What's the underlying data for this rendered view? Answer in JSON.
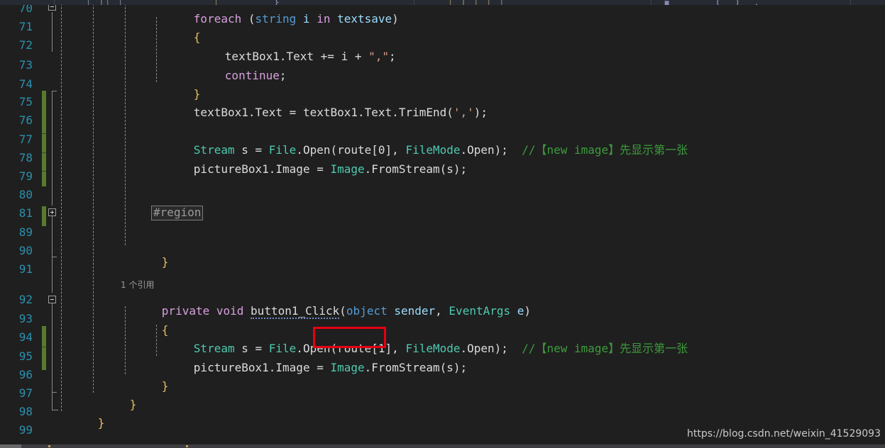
{
  "app": {
    "name": "visual-studio-code-editor",
    "language": "csharp",
    "theme": "dark"
  },
  "colors": {
    "background": "#1f1f1f",
    "line_number": "#2b91af",
    "keyword": "#d8a0df",
    "type": "#4ec9b0",
    "string": "#d69d85",
    "number": "#b5cea8",
    "comment": "#3d9c3d",
    "brace": "#e8bf6a",
    "plain": "#dcdcdc",
    "change_bar": "#577b2d",
    "annotation_box": "#e60012",
    "codelens": "#9a9a9a"
  },
  "gutter": {
    "line_numbers": [
      "70",
      "71",
      "72",
      "73",
      "74",
      "75",
      "76",
      "77",
      "78",
      "79",
      "80",
      "81",
      "89",
      "90",
      "91",
      "92",
      "93",
      "94",
      "95",
      "96",
      "97",
      "98",
      "99"
    ]
  },
  "codelens": {
    "references_label": "1 个引用"
  },
  "region": {
    "collapsed_label": "#region"
  },
  "annotation": {
    "highlight_text": "route[1],"
  },
  "watermark": {
    "text": "https://blog.csdn.net/weixin_41529093"
  },
  "code": {
    "lines": [
      {
        "n": "70",
        "text": "foreach (string i in textsave)"
      },
      {
        "n": "71",
        "text": "{"
      },
      {
        "n": "72",
        "text": "    textBox1.Text += i + \",\";"
      },
      {
        "n": "73",
        "text": "    continue;"
      },
      {
        "n": "74",
        "text": "}"
      },
      {
        "n": "75",
        "text": "textBox1.Text = textBox1.Text.TrimEnd(',');"
      },
      {
        "n": "76",
        "text": ""
      },
      {
        "n": "77",
        "text": "Stream s = File.Open(route[0], FileMode.Open);  //【new image】先显示第一张"
      },
      {
        "n": "78",
        "text": "pictureBox1.Image = Image.FromStream(s);"
      },
      {
        "n": "79",
        "text": ""
      },
      {
        "n": "80",
        "text": ""
      },
      {
        "n": "81",
        "text": "#region"
      },
      {
        "n": "89",
        "text": ""
      },
      {
        "n": "90",
        "text": "}"
      },
      {
        "n": "91",
        "text": ""
      },
      {
        "n": "92",
        "text": "private void button1_Click(object sender, EventArgs e)"
      },
      {
        "n": "93",
        "text": "{"
      },
      {
        "n": "94",
        "text": "    Stream s = File.Open(route[1], FileMode.Open);  //【new image】先显示第一张"
      },
      {
        "n": "95",
        "text": "    pictureBox1.Image = Image.FromStream(s);"
      },
      {
        "n": "96",
        "text": "}"
      },
      {
        "n": "97",
        "text": "}"
      },
      {
        "n": "98",
        "text": "}"
      },
      {
        "n": "99",
        "text": ""
      }
    ],
    "tokens": {
      "foreach": "foreach",
      "string": "string",
      "in": "in",
      "continue": "continue",
      "private": "private",
      "void": "void",
      "object": "object",
      "textsave": "textsave",
      "textBox1": "textBox1",
      "Text": "Text",
      "TrimEnd": "TrimEnd",
      "Stream": "Stream",
      "File": "File",
      "Open": "Open",
      "FileMode": "FileMode",
      "route0": "route[0]",
      "route1": "route[1]",
      "pictureBox1": "pictureBox1",
      "Image": "Image",
      "FromStream": "FromStream",
      "button1_Click": "button1_Click",
      "sender": "sender",
      "EventArgs": "EventArgs",
      "e": "e",
      "comment": "//【new image】先显示第一张"
    }
  }
}
